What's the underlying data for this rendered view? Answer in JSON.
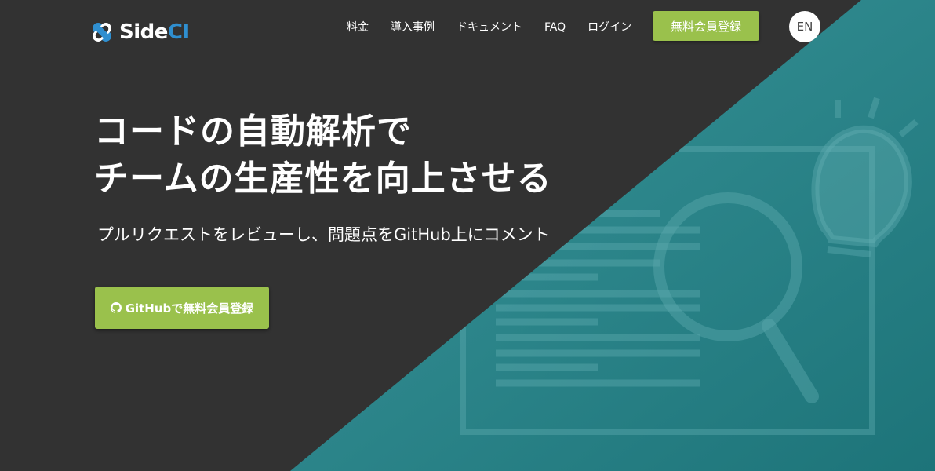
{
  "brand": {
    "logo_text_main": "Side",
    "logo_text_accent": "CI",
    "accent_color": "#2f8fd0"
  },
  "nav": {
    "links": [
      {
        "label": "料金"
      },
      {
        "label": "導入事例"
      },
      {
        "label": "ドキュメント"
      },
      {
        "label": "FAQ"
      },
      {
        "label": "ログイン"
      }
    ],
    "signup_label": "無料会員登録",
    "language_label": "EN"
  },
  "hero": {
    "headline_line1": "コードの自動解析で",
    "headline_line2": "チームの生産性を向上させる",
    "subheadline": "プルリクエストをレビューし、問題点をGitHub上にコメント",
    "cta_label": "GitHubで無料会員登録",
    "cta_icon": "github-icon"
  },
  "colors": {
    "background": "#323232",
    "teal": "#2a8a8f",
    "button_green": "#9ac14c"
  }
}
